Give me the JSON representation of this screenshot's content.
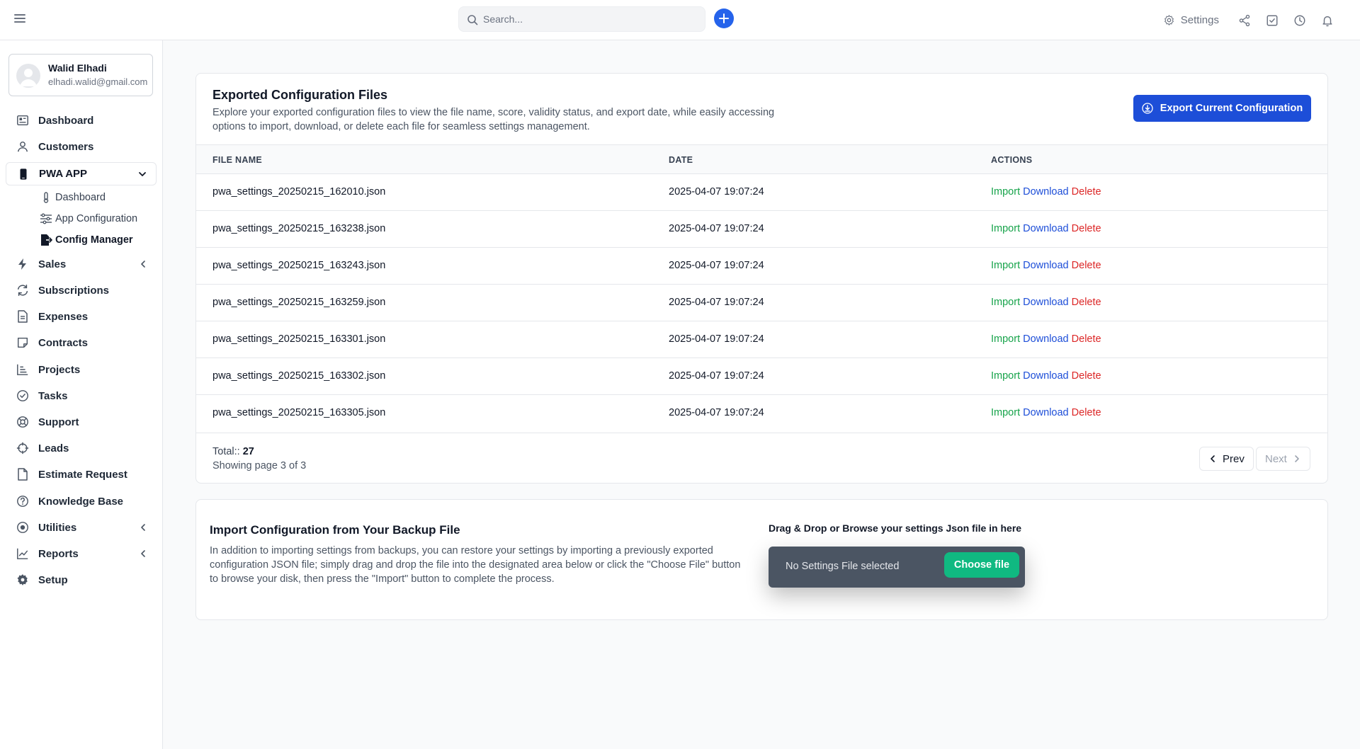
{
  "header": {
    "search_placeholder": "Search...",
    "settings_label": "Settings"
  },
  "user": {
    "name": "Walid Elhadi",
    "email": "elhadi.walid@gmail.com"
  },
  "sidebar": {
    "items": [
      {
        "label": "Dashboard",
        "icon": "dashboard-icon"
      },
      {
        "label": "Customers",
        "icon": "user-icon"
      },
      {
        "label": "PWA APP",
        "icon": "mobile-icon"
      },
      {
        "label": "Sales",
        "icon": "bolt-icon"
      },
      {
        "label": "Subscriptions",
        "icon": "refresh-icon"
      },
      {
        "label": "Expenses",
        "icon": "document-icon"
      },
      {
        "label": "Contracts",
        "icon": "note-icon"
      },
      {
        "label": "Projects",
        "icon": "chart-icon"
      },
      {
        "label": "Tasks",
        "icon": "check-circle-icon"
      },
      {
        "label": "Support",
        "icon": "lifebuoy-icon"
      },
      {
        "label": "Leads",
        "icon": "crosshair-icon"
      },
      {
        "label": "Estimate Request",
        "icon": "file-icon"
      },
      {
        "label": "Knowledge Base",
        "icon": "question-icon"
      },
      {
        "label": "Utilities",
        "icon": "target-icon"
      },
      {
        "label": "Reports",
        "icon": "line-chart-icon"
      },
      {
        "label": "Setup",
        "icon": "gear-icon"
      }
    ],
    "pwa_sub": [
      {
        "label": "Dashboard",
        "icon": "thermometer-icon"
      },
      {
        "label": "App Configuration",
        "icon": "sliders-icon"
      },
      {
        "label": "Config Manager",
        "icon": "file-export-icon"
      }
    ]
  },
  "exports": {
    "title": "Exported Configuration Files",
    "description": "Explore your exported configuration files to view the file name, score, validity status, and export date, while easily accessing options to import, download, or delete each file for seamless settings management.",
    "export_button": "Export Current Configuration",
    "columns": {
      "file": "FILE NAME",
      "date": "DATE",
      "actions": "ACTIONS"
    },
    "actions": {
      "import": "Import",
      "download": "Download",
      "delete": "Delete"
    },
    "rows": [
      {
        "file": "pwa_settings_20250215_162010.json",
        "date": "2025-04-07 19:07:24"
      },
      {
        "file": "pwa_settings_20250215_163238.json",
        "date": "2025-04-07 19:07:24"
      },
      {
        "file": "pwa_settings_20250215_163243.json",
        "date": "2025-04-07 19:07:24"
      },
      {
        "file": "pwa_settings_20250215_163259.json",
        "date": "2025-04-07 19:07:24"
      },
      {
        "file": "pwa_settings_20250215_163301.json",
        "date": "2025-04-07 19:07:24"
      },
      {
        "file": "pwa_settings_20250215_163302.json",
        "date": "2025-04-07 19:07:24"
      },
      {
        "file": "pwa_settings_20250215_163305.json",
        "date": "2025-04-07 19:07:24"
      }
    ],
    "total_label": "Total::",
    "total_value": "27",
    "page_info": "Showing page 3 of 3",
    "prev_label": "Prev",
    "next_label": "Next"
  },
  "import": {
    "title": "Import Configuration from Your Backup File",
    "description": "In addition to importing settings from backups, you can restore your settings by importing a previously exported configuration JSON file; simply drag and drop the file into the designated area below or click the \"Choose File\" button to browse your disk, then press the \"Import\" button to complete the process.",
    "drop_label": "Drag & Drop or Browse your settings Json file in here",
    "no_file": "No Settings File selected",
    "choose_button": "Choose file"
  },
  "colors": {
    "primary": "#1d4ed8",
    "import": "#16a34a",
    "delete": "#dc2626",
    "choose": "#10b981"
  }
}
